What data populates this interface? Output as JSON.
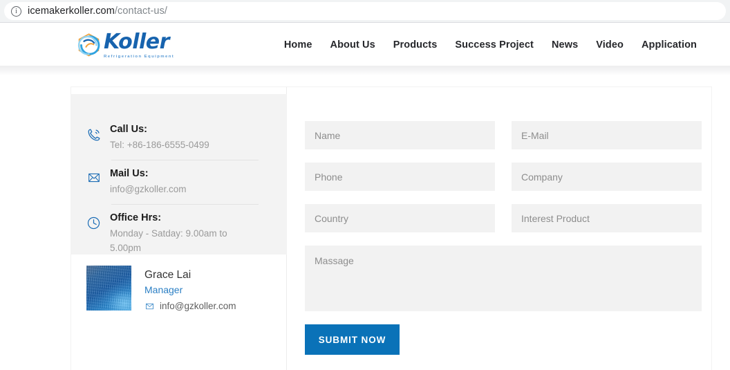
{
  "browser": {
    "security_icon": "info-circle-icon",
    "url_domain": "icemakerkoller.com",
    "url_path": "/contact-us/"
  },
  "header": {
    "logo": {
      "icon": "koller-swirl-logo-icon",
      "word": "Koller",
      "subtitle": "Refrigeration Equipment"
    },
    "nav": [
      {
        "label": "Home"
      },
      {
        "label": "About Us"
      },
      {
        "label": "Products"
      },
      {
        "label": "Success Project"
      },
      {
        "label": "News"
      },
      {
        "label": "Video"
      },
      {
        "label": "Application"
      }
    ]
  },
  "contact_info": [
    {
      "icon": "phone-icon",
      "title": "Call Us:",
      "text": "Tel: +86-186-6555-0499"
    },
    {
      "icon": "envelope-icon",
      "title": "Mail Us:",
      "text": "info@gzkoller.com"
    },
    {
      "icon": "clock-icon",
      "title": "Office Hrs:",
      "text": "Monday - Satday: 9.00am to 5.00pm"
    }
  ],
  "person": {
    "avatar_alt": "ice-texture-avatar",
    "name": "Grace Lai",
    "role": "Manager",
    "email": "info@gzkoller.com",
    "email_icon": "envelope-icon"
  },
  "form": {
    "fields": {
      "name": {
        "placeholder": "Name",
        "value": ""
      },
      "email": {
        "placeholder": "E-Mail",
        "value": ""
      },
      "phone": {
        "placeholder": "Phone",
        "value": ""
      },
      "company": {
        "placeholder": "Company",
        "value": ""
      },
      "country": {
        "placeholder": "Country",
        "value": ""
      },
      "interest_product": {
        "placeholder": "Interest Product",
        "value": ""
      },
      "message": {
        "placeholder": "Massage",
        "value": ""
      }
    },
    "submit_label": "SUBMIT NOW"
  },
  "colors": {
    "brand_blue": "#1763ae",
    "button_blue": "#0a72b8",
    "link_blue": "#2b7fc4",
    "panel_gray": "#f3f3f3",
    "field_gray": "#f2f2f2"
  }
}
